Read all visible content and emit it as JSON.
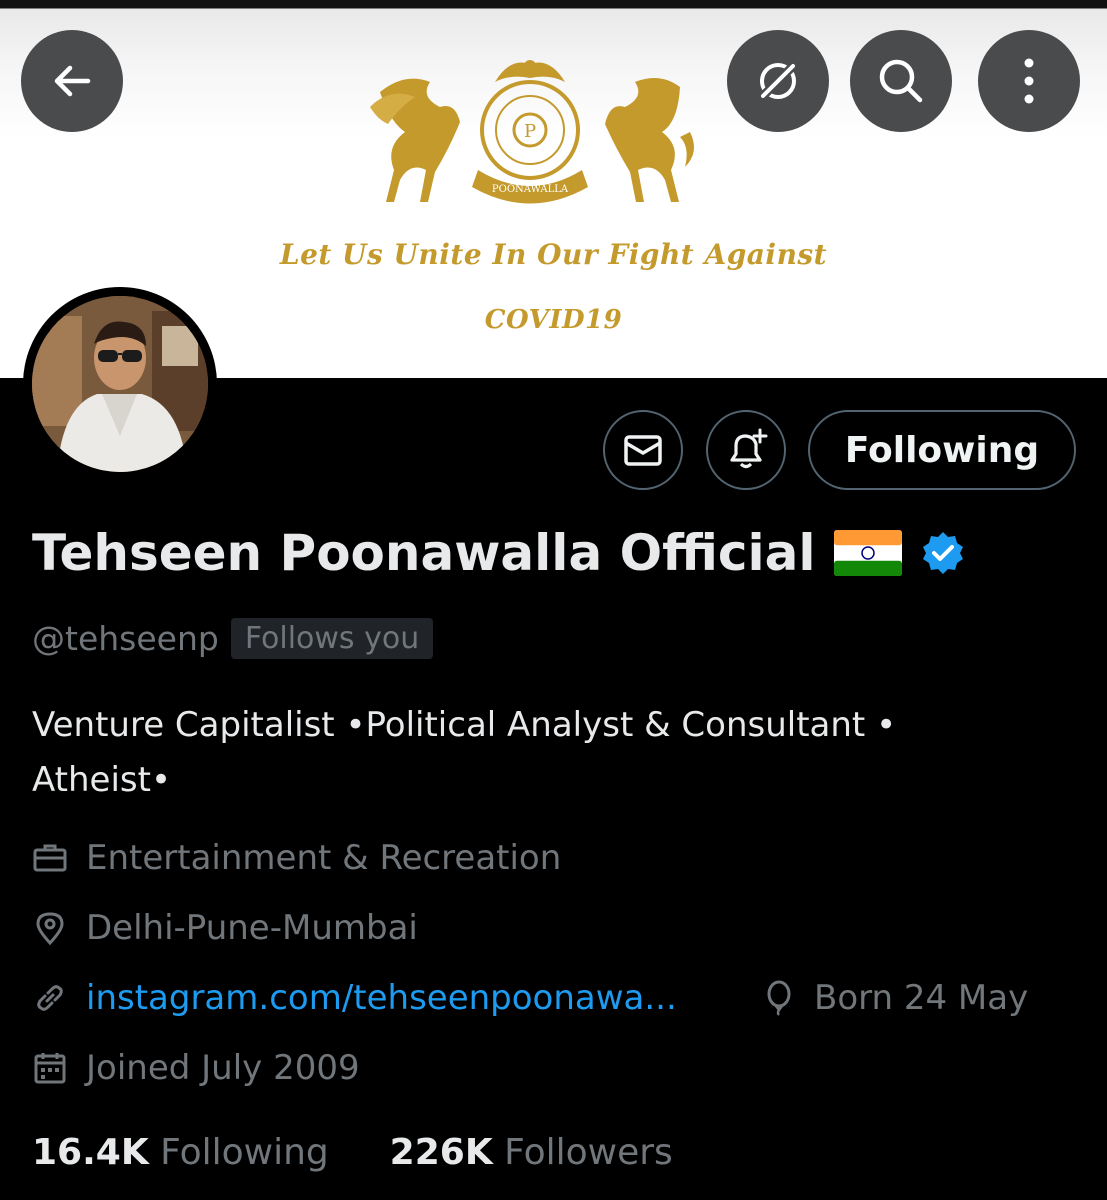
{
  "banner": {
    "line1": "Let Us Unite In Our Fight Against",
    "line2": "COVID19",
    "crest_text": "POONAWALLA",
    "crest_initial": "P"
  },
  "header_buttons": {
    "back": "back-arrow-icon",
    "grok": "grok-icon",
    "search": "search-icon",
    "more": "more-vertical-icon"
  },
  "actions": {
    "message_icon": "envelope-icon",
    "notify_icon": "bell-plus-icon",
    "following_label": "Following"
  },
  "profile": {
    "name": "Tehseen Poonawalla Official",
    "handle": "@tehseenp",
    "follows_you": "Follows you",
    "bio_line1": "Venture Capitalist •Political Analyst & Consultant •",
    "bio_line2": "Atheist•",
    "category": "Entertainment & Recreation",
    "location": "Delhi-Pune-Mumbai",
    "website": "instagram.com/tehseenpoonawa...",
    "birthday": "Born 24 May",
    "joined": "Joined July 2009"
  },
  "stats": {
    "following_count": "16.4K",
    "following_label": "Following",
    "followers_count": "226K",
    "followers_label": "Followers"
  },
  "colors": {
    "background": "#000000",
    "gold": "#c49a2c",
    "link": "#1d9bf0",
    "verified": "#1d9bf0",
    "muted": "#71767b"
  }
}
